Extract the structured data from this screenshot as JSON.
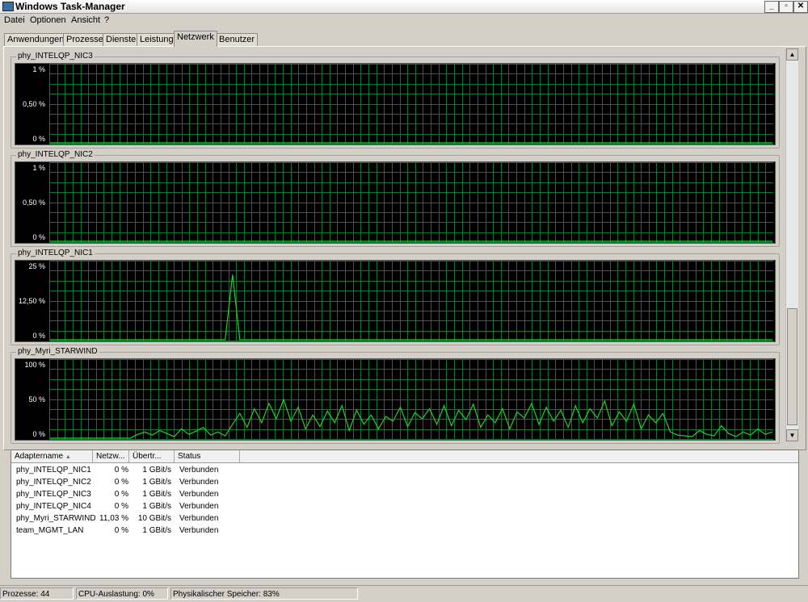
{
  "window": {
    "title": "Windows Task-Manager",
    "minimize": "_",
    "restore": "▫",
    "close": "✕"
  },
  "menu": [
    "Datei",
    "Optionen",
    "Ansicht",
    "?"
  ],
  "tabs": [
    "Anwendungen",
    "Prozesse",
    "Dienste",
    "Leistung",
    "Netzwerk",
    "Benutzer"
  ],
  "active_tab": "Netzwerk",
  "graph_color": "#1fd41f",
  "grid_color": "#0a7a3a",
  "graphs": [
    {
      "name": "phy_INTELQP_NIC3",
      "ticks": [
        "1 %",
        "0,50 %",
        "0 %"
      ]
    },
    {
      "name": "phy_INTELQP_NIC2",
      "ticks": [
        "1 %",
        "0,50 %",
        "0 %"
      ]
    },
    {
      "name": "phy_INTELQP_NIC1",
      "ticks": [
        "25 %",
        "12,50 %",
        "0 %"
      ]
    },
    {
      "name": "phy_Myri_STARWIND",
      "ticks": [
        "100 %",
        "50 %",
        "0 %"
      ]
    }
  ],
  "chart_data": [
    {
      "type": "line",
      "series": [
        {
          "values": [
            0,
            0,
            0,
            0,
            0,
            0,
            0,
            0,
            0,
            0,
            0,
            0,
            0,
            0,
            0,
            0,
            0,
            0,
            0,
            0,
            0,
            0,
            0,
            0,
            0,
            0,
            0,
            0,
            0,
            0,
            0,
            0,
            0,
            0,
            0,
            0,
            0,
            0,
            0,
            0,
            0,
            0,
            0,
            0,
            0,
            0,
            0,
            0,
            0,
            0,
            0,
            0,
            0,
            0,
            0,
            0,
            0,
            0,
            0,
            0,
            0,
            0,
            0,
            0,
            0,
            0,
            0,
            0,
            0,
            0,
            0,
            0,
            0,
            0,
            0,
            0,
            0,
            0,
            0,
            0,
            0,
            0,
            0,
            0,
            0,
            0,
            0,
            0,
            0,
            0,
            0,
            0,
            0,
            0,
            0,
            0,
            0,
            0,
            0,
            0
          ]
        }
      ],
      "ylim": [
        0,
        1
      ]
    },
    {
      "type": "line",
      "series": [
        {
          "values": [
            0,
            0,
            0,
            0,
            0,
            0,
            0,
            0,
            0,
            0,
            0,
            0,
            0,
            0,
            0,
            0,
            0,
            0,
            0,
            0,
            0,
            0,
            0,
            0,
            0,
            0,
            0,
            0,
            0,
            0,
            0,
            0,
            0,
            0,
            0,
            0,
            0,
            0,
            0,
            0,
            0,
            0,
            0,
            0,
            0,
            0,
            0,
            0,
            0,
            0,
            0,
            0,
            0,
            0,
            0,
            0,
            0,
            0,
            0,
            0,
            0,
            0,
            0,
            0,
            0,
            0,
            0,
            0,
            0,
            0,
            0,
            0,
            0,
            0,
            0,
            0,
            0,
            0,
            0,
            0,
            0,
            0,
            0,
            0,
            0,
            0,
            0,
            0,
            0,
            0,
            0,
            0,
            0,
            0,
            0,
            0,
            0,
            0,
            0,
            0
          ]
        }
      ],
      "ylim": [
        0,
        1
      ]
    },
    {
      "type": "line",
      "series": [
        {
          "values": [
            0,
            0,
            0,
            0,
            0,
            0,
            0,
            0,
            0,
            0,
            0,
            0,
            0,
            0,
            0,
            0,
            0,
            0,
            0,
            0,
            0,
            0,
            0,
            0,
            0,
            21,
            0,
            0,
            0,
            0,
            0,
            0,
            0,
            0,
            0,
            0,
            0,
            0,
            0,
            0,
            0,
            0,
            0,
            0,
            0,
            0,
            0,
            0,
            0,
            0,
            0,
            0,
            0,
            0,
            0,
            0,
            0,
            0,
            0,
            0,
            0,
            0,
            0,
            0,
            0,
            0,
            0,
            0,
            0,
            0,
            0,
            0,
            0,
            0,
            0,
            0,
            0,
            0,
            0,
            0,
            0,
            0,
            0,
            0,
            0,
            0,
            0,
            0,
            0,
            0,
            0,
            0,
            0,
            0,
            0,
            0,
            0,
            0,
            0,
            0
          ]
        }
      ],
      "ylim": [
        0,
        25
      ]
    },
    {
      "type": "line",
      "series": [
        {
          "values": [
            0,
            0,
            0,
            0,
            0,
            0,
            0,
            0,
            0,
            0,
            0,
            0,
            5,
            8,
            4,
            10,
            6,
            2,
            12,
            5,
            9,
            14,
            4,
            8,
            3,
            18,
            32,
            14,
            38,
            20,
            45,
            25,
            50,
            22,
            40,
            12,
            30,
            15,
            35,
            20,
            42,
            10,
            36,
            18,
            30,
            12,
            28,
            22,
            40,
            15,
            33,
            25,
            38,
            18,
            42,
            16,
            36,
            24,
            44,
            14,
            30,
            20,
            38,
            12,
            34,
            26,
            45,
            18,
            40,
            22,
            36,
            14,
            42,
            20,
            38,
            26,
            48,
            16,
            34,
            22,
            44,
            12,
            30,
            20,
            32,
            8,
            4,
            3,
            2,
            10,
            5,
            3,
            16,
            6,
            2,
            8,
            4,
            12,
            5,
            8
          ]
        }
      ],
      "ylim": [
        0,
        100
      ]
    }
  ],
  "list": {
    "columns": [
      "Adaptername",
      "Netzw...",
      "Übertr...",
      "Status"
    ],
    "rows": [
      [
        "phy_INTELQP_NIC1",
        "0 %",
        "1 GBit/s",
        "Verbunden"
      ],
      [
        "phy_INTELQP_NIC2",
        "0 %",
        "1 GBit/s",
        "Verbunden"
      ],
      [
        "phy_INTELQP_NIC3",
        "0 %",
        "1 GBit/s",
        "Verbunden"
      ],
      [
        "phy_INTELQP_NIC4",
        "0 %",
        "1 GBit/s",
        "Verbunden"
      ],
      [
        "phy_Myri_STARWIND",
        "11,03 %",
        "10 GBit/s",
        "Verbunden"
      ],
      [
        "team_MGMT_LAN",
        "0 %",
        "1 GBit/s",
        "Verbunden"
      ]
    ]
  },
  "status": {
    "processes": "Prozesse: 44",
    "cpu": "CPU-Auslastung: 0%",
    "memory": "Physikalischer Speicher: 83%"
  }
}
